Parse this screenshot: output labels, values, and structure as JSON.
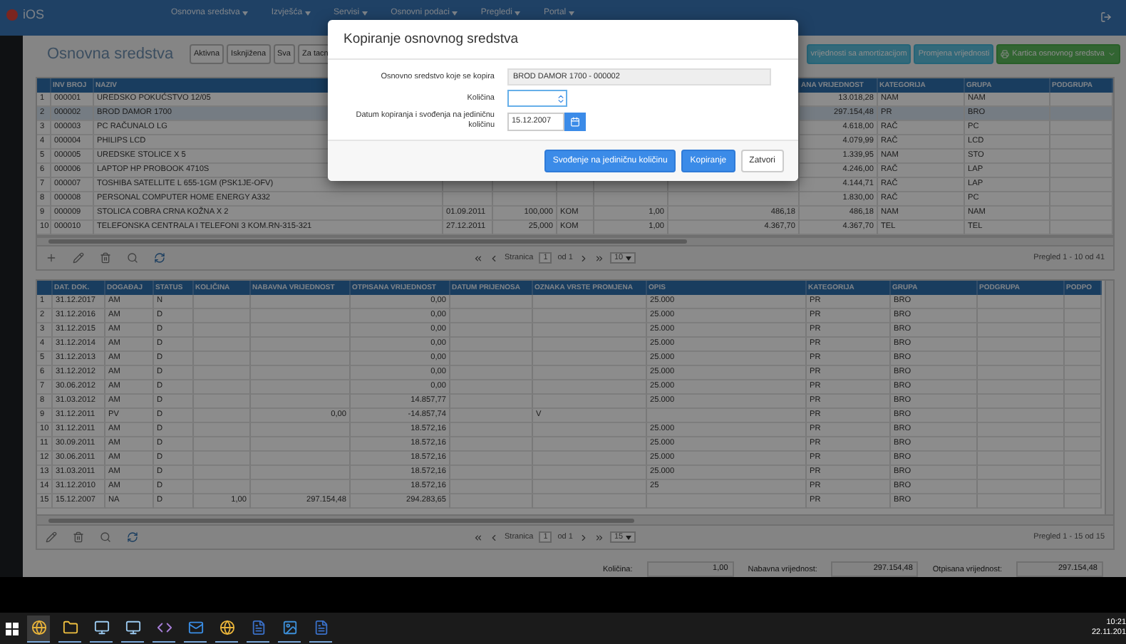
{
  "nav": {
    "logo": "iOS",
    "menus": [
      "Osnovna sredstva",
      "Izvješća",
      "Servisi",
      "Osnovni podaci",
      "Pregledi",
      "Portal"
    ]
  },
  "page": {
    "title": "Osnovna sredstva",
    "filters": [
      "Aktivna",
      "Isknjižena",
      "Sva",
      "Za tacn"
    ],
    "actions": [
      {
        "label": "vrijednosti sa amortizacijom",
        "kind": "plain"
      },
      {
        "label": "Promjena vrijednosti",
        "kind": "plain"
      },
      {
        "label": "Kartica osnovnog sredstva",
        "kind": "primary"
      }
    ]
  },
  "assets_table": {
    "columns": [
      null,
      "INV BROJ",
      "NAZIV",
      null,
      null,
      null,
      null,
      null,
      "ANA VRIJEDNOST",
      "KATEGORIJA",
      "GRUPA",
      "PODGRUPA"
    ],
    "rows": [
      {
        "selected": false,
        "cells": [
          "1",
          "000001",
          "UREDSKO POKUĆSTVO 12/05",
          null,
          null,
          null,
          null,
          null,
          "13.018,28",
          "NAM",
          "NAM",
          null
        ]
      },
      {
        "selected": true,
        "cells": [
          "2",
          "000002",
          "BROD DAMOR 1700",
          null,
          null,
          null,
          null,
          null,
          "297.154,48",
          "PR",
          "BRO",
          null
        ]
      },
      {
        "selected": false,
        "cells": [
          "3",
          "000003",
          "PC RAČUNALO LG",
          null,
          null,
          null,
          null,
          null,
          "4.618,00",
          "RAČ",
          "PC",
          null
        ]
      },
      {
        "selected": false,
        "cells": [
          "4",
          "000004",
          "PHILIPS LCD",
          null,
          null,
          null,
          null,
          null,
          "4.079,99",
          "RAČ",
          "LCD",
          null
        ]
      },
      {
        "selected": false,
        "cells": [
          "5",
          "000005",
          "UREDSKE STOLICE X 5",
          null,
          null,
          null,
          null,
          null,
          "1.339,95",
          "NAM",
          "STO",
          null
        ]
      },
      {
        "selected": false,
        "cells": [
          "6",
          "000006",
          "LAPTOP HP PROBOOK 4710S",
          null,
          null,
          null,
          null,
          null,
          "4.246,00",
          "RAČ",
          "LAP",
          null
        ]
      },
      {
        "selected": false,
        "cells": [
          "7",
          "000007",
          "TOSHIBA SATELLITE L 655-1GM (PSK1JE-OFV)",
          null,
          null,
          null,
          null,
          null,
          "4.144,71",
          "RAČ",
          "LAP",
          null
        ]
      },
      {
        "selected": false,
        "cells": [
          "8",
          "000008",
          "PERSONAL COMPUTER HOME ENERGY A332",
          null,
          null,
          null,
          null,
          null,
          "1.830,00",
          "RAČ",
          "PC",
          null
        ]
      },
      {
        "selected": false,
        "cells": [
          "9",
          "000009",
          "STOLICA COBRA CRNA KOŽNA X 2",
          "01.09.2011",
          "100,000",
          "KOM",
          "1,00",
          "486,18",
          "486,18",
          "NAM",
          "NAM",
          null
        ]
      },
      {
        "selected": false,
        "cells": [
          "10",
          "000010",
          "TELEFONSKA CENTRALA I TELEFONI 3 KOM.RN-315-321",
          "27.12.2011",
          "25,000",
          "KOM",
          "1,00",
          "4.367,70",
          "4.367,70",
          "TEL",
          "TEL",
          null
        ]
      }
    ],
    "pager": {
      "page_label": "Stranica",
      "page": "1",
      "of": "od 1",
      "size": "10",
      "summary": "Pregled 1 - 10 od 41"
    }
  },
  "history_table": {
    "columns": [
      null,
      "DAT. DOK.",
      "DOGAĐAJ",
      "STATUS",
      "KOLIČINA",
      "NABAVNA VRIJEDNOST",
      "OTPISANA VRIJEDNOST",
      "DATUM PRIJENOSA",
      "OZNAKA VRSTE PROMJENA",
      "OPIS",
      "KATEGORIJA",
      "GRUPA",
      "PODGRUPA",
      "PODPO"
    ],
    "rows": [
      [
        "1",
        "31.12.2017",
        "AM",
        "N",
        null,
        null,
        "0,00",
        null,
        null,
        "25.000",
        "PR",
        "BRO",
        null,
        null
      ],
      [
        "2",
        "31.12.2016",
        "AM",
        "D",
        null,
        null,
        "0,00",
        null,
        null,
        "25.000",
        "PR",
        "BRO",
        null,
        null
      ],
      [
        "3",
        "31.12.2015",
        "AM",
        "D",
        null,
        null,
        "0,00",
        null,
        null,
        "25.000",
        "PR",
        "BRO",
        null,
        null
      ],
      [
        "4",
        "31.12.2014",
        "AM",
        "D",
        null,
        null,
        "0,00",
        null,
        null,
        "25.000",
        "PR",
        "BRO",
        null,
        null
      ],
      [
        "5",
        "31.12.2013",
        "AM",
        "D",
        null,
        null,
        "0,00",
        null,
        null,
        "25.000",
        "PR",
        "BRO",
        null,
        null
      ],
      [
        "6",
        "31.12.2012",
        "AM",
        "D",
        null,
        null,
        "0,00",
        null,
        null,
        "25.000",
        "PR",
        "BRO",
        null,
        null
      ],
      [
        "7",
        "30.06.2012",
        "AM",
        "D",
        null,
        null,
        "0,00",
        null,
        null,
        "25.000",
        "PR",
        "BRO",
        null,
        null
      ],
      [
        "8",
        "31.03.2012",
        "AM",
        "D",
        null,
        null,
        "14.857,77",
        null,
        null,
        "25.000",
        "PR",
        "BRO",
        null,
        null
      ],
      [
        "9",
        "31.12.2011",
        "PV",
        "D",
        null,
        "0,00",
        "-14.857,74",
        null,
        "V",
        null,
        "PR",
        "BRO",
        null,
        null
      ],
      [
        "10",
        "31.12.2011",
        "AM",
        "D",
        null,
        null,
        "18.572,16",
        null,
        null,
        "25.000",
        "PR",
        "BRO",
        null,
        null
      ],
      [
        "11",
        "30.09.2011",
        "AM",
        "D",
        null,
        null,
        "18.572,16",
        null,
        null,
        "25.000",
        "PR",
        "BRO",
        null,
        null
      ],
      [
        "12",
        "30.06.2011",
        "AM",
        "D",
        null,
        null,
        "18.572,16",
        null,
        null,
        "25.000",
        "PR",
        "BRO",
        null,
        null
      ],
      [
        "13",
        "31.03.2011",
        "AM",
        "D",
        null,
        null,
        "18.572,16",
        null,
        null,
        "25.000",
        "PR",
        "BRO",
        null,
        null
      ],
      [
        "14",
        "31.12.2010",
        "AM",
        "D",
        null,
        null,
        "18.572,16",
        null,
        null,
        "25",
        "PR",
        "BRO",
        null,
        null
      ],
      [
        "15",
        "15.12.2007",
        "NA",
        "D",
        "1,00",
        "297.154,48",
        "294.283,65",
        null,
        null,
        null,
        "PR",
        "BRO",
        null,
        null
      ]
    ],
    "pager": {
      "page_label": "Stranica",
      "page": "1",
      "of": "od 1",
      "size": "15",
      "summary": "Pregled 1 - 15 od 15"
    }
  },
  "totals": [
    {
      "label": "Količina:",
      "value": "1,00"
    },
    {
      "label": "Nabavna vrijednost:",
      "value": "297.154,48"
    },
    {
      "label": "Otpisana vrijednost:",
      "value": "297.154,48"
    }
  ],
  "dialog": {
    "title": "Kopiranje osnovnog sredstva",
    "fields": [
      {
        "kind": "readonly",
        "label": "Osnovno sredstvo koje se kopira",
        "value": "BROD DAMOR 1700 - 000002"
      },
      {
        "kind": "number",
        "label": "Količina"
      },
      {
        "kind": "date",
        "label": "Datum kopiranja i svođenja na jediničnu količinu",
        "value": "15.12.2007"
      }
    ],
    "buttons": [
      {
        "label": "Svođenje na jediničnu količinu",
        "kind": "primary"
      },
      {
        "label": "Kopiranje",
        "kind": "primary"
      },
      {
        "label": "Zatvori",
        "kind": "default"
      }
    ]
  },
  "taskbar": {
    "time": "10:21",
    "date": "22.11.201"
  }
}
